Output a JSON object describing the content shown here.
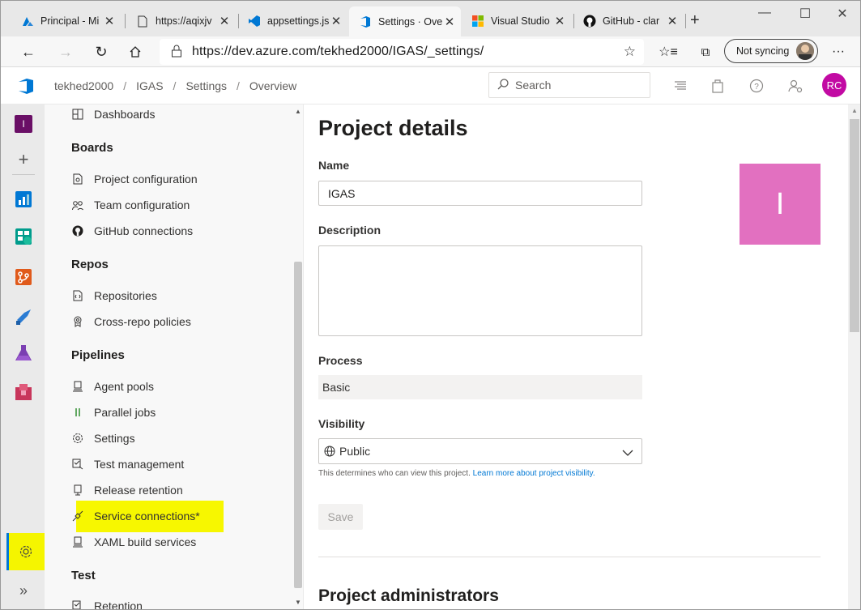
{
  "browser": {
    "tabs": [
      {
        "title": "Principal - Mi",
        "icon": "azure-icon"
      },
      {
        "title": "https://aqixjv",
        "icon": "page-icon"
      },
      {
        "title": "appsettings.js",
        "icon": "vscode-icon"
      },
      {
        "title": "Settings · Ove",
        "icon": "azure-devops-icon"
      },
      {
        "title": "Visual Studio",
        "icon": "microsoft-icon"
      },
      {
        "title": "GitHub - clar",
        "icon": "github-icon"
      }
    ],
    "url": "https://dev.azure.com/tekhed2000/IGAS/_settings/",
    "sync_label": "Not syncing"
  },
  "header": {
    "breadcrumb": [
      "tekhed2000",
      "IGAS",
      "Settings",
      "Overview"
    ],
    "search_placeholder": "Search",
    "avatar_initials": "RC"
  },
  "rail": {
    "project_initial": "I"
  },
  "nav": {
    "top_item": "Dashboards",
    "groups": [
      {
        "title": "Boards",
        "items": [
          "Project configuration",
          "Team configuration",
          "GitHub connections"
        ]
      },
      {
        "title": "Repos",
        "items": [
          "Repositories",
          "Cross-repo policies"
        ]
      },
      {
        "title": "Pipelines",
        "items": [
          "Agent pools",
          "Parallel jobs",
          "Settings",
          "Test management",
          "Release retention",
          "Service connections*",
          "XAML build services"
        ]
      },
      {
        "title": "Test",
        "items": [
          "Retention"
        ]
      }
    ]
  },
  "main": {
    "title": "Project details",
    "name_label": "Name",
    "name_value": "IGAS",
    "description_label": "Description",
    "description_value": "",
    "process_label": "Process",
    "process_value": "Basic",
    "visibility_label": "Visibility",
    "visibility_value": "Public",
    "visibility_help": "This determines who can view this project.",
    "visibility_link": "Learn more about project visibility.",
    "save_label": "Save",
    "project_image_letter": "I",
    "admins_title": "Project administrators"
  },
  "colors": {
    "highlight": "#f7f700",
    "project_tile": "#e270c0",
    "avatar": "#c20aa3",
    "accent": "#0078d4"
  }
}
